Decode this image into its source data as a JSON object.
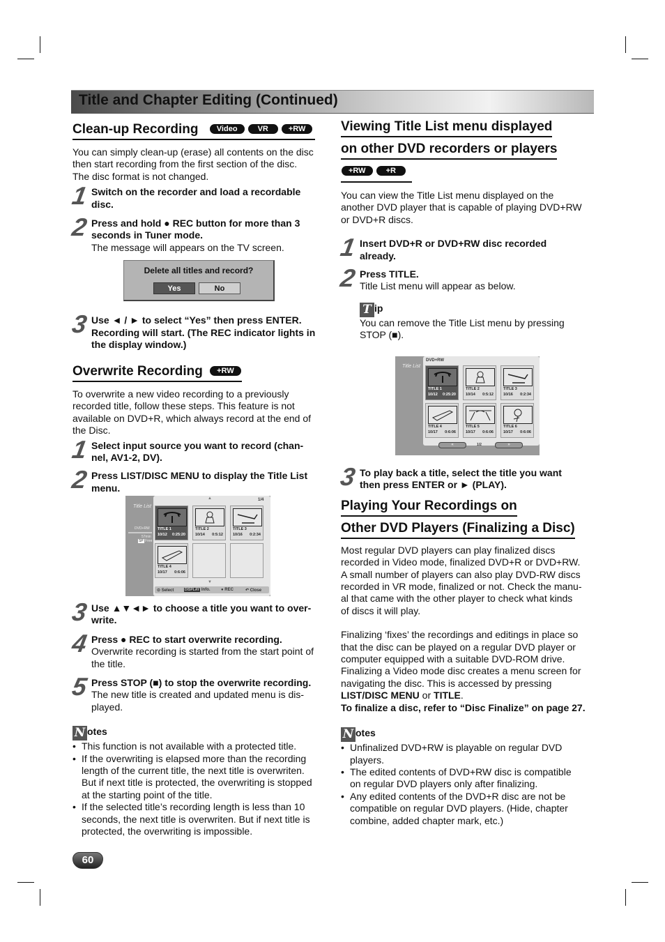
{
  "banner": {
    "title": "Title and Chapter Editing (Continued)"
  },
  "left": {
    "cleanup": {
      "heading": "Clean-up Recording",
      "badges": [
        "Video",
        "VR",
        "+RW"
      ],
      "intro": [
        "You can simply clean-up (erase) all contents on the disc",
        "then start recording from the first section of the disc.",
        "The disc format is not changed."
      ],
      "steps": [
        {
          "num": "1",
          "bold": [
            "Switch on the recorder and load a recordable",
            "disc."
          ],
          "text": []
        },
        {
          "num": "2",
          "bold": [
            "Press and hold ● REC button for more than 3",
            "seconds in Tuner mode."
          ],
          "text": [
            "The message will appears on the TV screen."
          ]
        },
        {
          "num": "3",
          "bold": [
            "Use ◄ / ► to select “Yes” then press ENTER.",
            "Recording will start. (The REC indicator lights in",
            "the display window.)"
          ],
          "text": []
        }
      ],
      "dialog": {
        "question": "Delete all titles and record?",
        "yes": "Yes",
        "no": "No"
      }
    },
    "overwrite": {
      "heading": "Overwrite Recording",
      "badges": [
        "+RW"
      ],
      "intro": [
        "To overwrite a new video recording to a previously",
        "recorded title, follow these steps. This feature is not",
        "available on DVD+R, which always record at the end of",
        "the Disc."
      ],
      "steps": [
        {
          "num": "1",
          "bold": [
            "Select input source you want to record (chan-",
            "nel, AV1-2, DV)."
          ],
          "text": []
        },
        {
          "num": "2",
          "bold": [
            "Press LIST/DISC MENU to display the Title List",
            "menu."
          ],
          "text": []
        },
        {
          "num": "3",
          "bold": [
            "Use ▲▼◄► to choose a title you want to over-",
            "write."
          ],
          "text": []
        },
        {
          "num": "4",
          "bold": [
            "Press ● REC to start overwrite recording."
          ],
          "text": [
            "Overwrite recording is started from the start point of",
            "the title."
          ]
        },
        {
          "num": "5",
          "bold": [
            "Press STOP (■) to stop the overwrite recording."
          ],
          "text": [
            "The new title is created and updated menu is dis-",
            "played."
          ]
        }
      ],
      "menu": {
        "side_label": "Title List",
        "disc": "DVD+RW",
        "free_time": "57min",
        "mode": "SP",
        "free_label": "Free",
        "page": "1/4",
        "titles": [
          {
            "name": "TITLE 1",
            "date": "10/12",
            "duration": "0:25:20",
            "selected": true
          },
          {
            "name": "TITLE 2",
            "date": "10/14",
            "duration": "0:5:12",
            "selected": false
          },
          {
            "name": "TITLE 3",
            "date": "10/16",
            "duration": "0:2:34",
            "selected": false
          },
          {
            "name": "TITLE 4",
            "date": "10/17",
            "duration": "0:6:06",
            "selected": false
          }
        ],
        "footer": {
          "select": "Select",
          "display_key": "DISPLAY",
          "info": "Info.",
          "rec": "REC",
          "close": "Close"
        }
      },
      "notes": {
        "icon_letter": "N",
        "label": "otes",
        "items": [
          [
            "This function is not available with a protected title."
          ],
          [
            "If the overwriting is elapsed more than the recording",
            "length of the current title, the next title is overwriten.",
            "But if next title is protected, the overwriting is stopped",
            "at the starting point of the title."
          ],
          [
            "If the selected title’s recording length is less than 10",
            "seconds, the next title is overwriten. But if next title is",
            "protected, the overwriting is impossible."
          ]
        ]
      }
    }
  },
  "right": {
    "viewing": {
      "heading": [
        "Viewing Title List menu displayed",
        "on other DVD recorders or players"
      ],
      "badges": [
        "+RW",
        "+R"
      ],
      "intro": [
        "You can view the Title List menu displayed on the",
        "another DVD player that is capable of playing DVD+RW",
        "or DVD+R discs."
      ],
      "steps": [
        {
          "num": "1",
          "bold": [
            "Insert DVD+R or DVD+RW disc recorded",
            "already."
          ],
          "text": []
        },
        {
          "num": "2",
          "bold": [
            "Press TITLE."
          ],
          "text": [
            "Title List menu will appear as below."
          ]
        }
      ],
      "tip": {
        "icon_letter": "T",
        "label": "ip",
        "text": [
          "You can remove the Title List menu by pressing",
          "STOP (■)."
        ]
      },
      "menu": {
        "side_label": "Title List",
        "disc": "DVD+RW",
        "page": "1/2",
        "prev": "«",
        "next": "»",
        "titles": [
          {
            "name": "TITLE 1",
            "date": "10/12",
            "duration": "0:25:20",
            "selected": true
          },
          {
            "name": "TITLE 2",
            "date": "10/14",
            "duration": "0:5:12",
            "selected": false
          },
          {
            "name": "TITLE 3",
            "date": "10/16",
            "duration": "0:2:34",
            "selected": false
          },
          {
            "name": "TITLE 4",
            "date": "10/17",
            "duration": "0:6:06",
            "selected": false
          },
          {
            "name": "TITLE 5",
            "date": "10/17",
            "duration": "0:6:06",
            "selected": false
          },
          {
            "name": "TITLE 6",
            "date": "10/17",
            "duration": "0:6:06",
            "selected": false
          }
        ]
      },
      "step3": {
        "num": "3",
        "bold": [
          "To play back a title, select the title you want",
          "then press ENTER or ► (PLAY)."
        ]
      }
    },
    "finalizing": {
      "heading": [
        "Playing Your Recordings on",
        "Other DVD Players (Finalizing a Disc)"
      ],
      "para1": [
        "Most regular DVD players can play finalized discs",
        "recorded in Video mode, finalized DVD+R or DVD+RW.",
        "A small number of players can also play DVD-RW discs",
        "recorded in VR mode, finalized or not. Check the manu-",
        "al that came with the other player to check what kinds",
        "of discs it will play."
      ],
      "para2": [
        "Finalizing ‘fixes’ the recordings and editings in place so",
        "that the disc can be played on a regular DVD player or",
        "computer equipped with a suitable DVD-ROM drive.",
        "Finalizing a Video mode disc creates a menu screen for",
        "navigating the disc. This is accessed by pressing"
      ],
      "para2_last": {
        "b1": "LIST/DISC MENU",
        "mid": " or ",
        "b2": "TITLE",
        "end": "."
      },
      "para2_ref": "To finalize a disc, refer to “Disc Finalize” on page 27.",
      "notes": {
        "icon_letter": "N",
        "label": "otes",
        "items": [
          [
            "Unfinalized DVD+RW is playable on regular DVD",
            "players."
          ],
          [
            "The edited contents of DVD+RW disc is compatible",
            "on regular DVD players only after finalizing."
          ],
          [
            "Any edited contents of the DVD+R disc are not be",
            "compatible on regular DVD players. (Hide, chapter",
            "combine, added chapter mark, etc.)"
          ]
        ]
      }
    }
  },
  "page_number": "60"
}
